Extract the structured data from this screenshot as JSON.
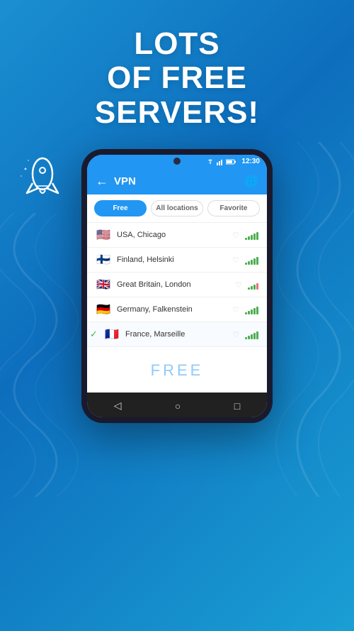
{
  "background": {
    "gradient_start": "#1a8fd1",
    "gradient_end": "#0d6ebd"
  },
  "header": {
    "line1": "Lots",
    "line2": "of free",
    "line3": "servers!"
  },
  "phone": {
    "status_bar": {
      "time": "12:30"
    },
    "app_header": {
      "title": "VPN",
      "back_label": "←",
      "globe_label": "🌐"
    },
    "tabs": [
      {
        "label": "Free",
        "active": true
      },
      {
        "label": "All locations",
        "active": false
      },
      {
        "label": "Favorite",
        "active": false
      }
    ],
    "servers": [
      {
        "country": "USA, Chicago",
        "flag": "🇺🇸",
        "selected": false,
        "signal": [
          3,
          5,
          7,
          9,
          11
        ]
      },
      {
        "country": "Finland, Helsinki",
        "flag": "🇫🇮",
        "selected": false,
        "signal": [
          3,
          5,
          7,
          9,
          11
        ]
      },
      {
        "country": "Great Britain, London",
        "flag": "🇬🇧",
        "selected": false,
        "signal": [
          3,
          5,
          7,
          9
        ]
      },
      {
        "country": "Germany, Falkenstein",
        "flag": "🇩🇪",
        "selected": false,
        "signal": [
          3,
          5,
          7,
          9,
          11
        ]
      },
      {
        "country": "France, Marseille",
        "flag": "🇫🇷",
        "selected": true,
        "signal": [
          3,
          5,
          7,
          9,
          11
        ]
      }
    ],
    "free_label": "FREE",
    "nav": {
      "back": "◁",
      "home": "○",
      "recent": "□"
    }
  }
}
